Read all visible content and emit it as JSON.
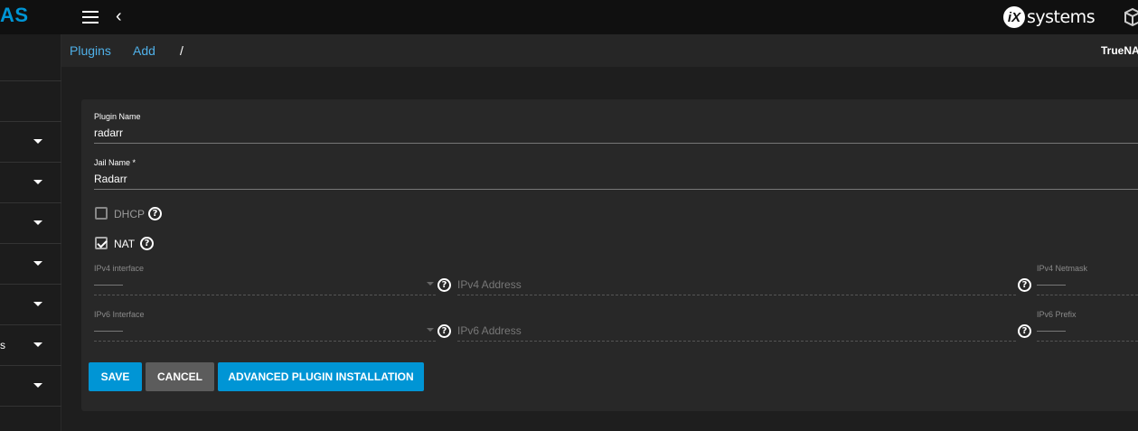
{
  "topbar": {
    "logo_text": "AS",
    "vendor_mark": "iX",
    "vendor_text": "systems"
  },
  "sidebar": {
    "items": [
      {
        "label": ""
      },
      {
        "label": ""
      },
      {
        "label": ""
      },
      {
        "label": ""
      },
      {
        "label": ""
      },
      {
        "label": "s"
      },
      {
        "label": ""
      }
    ]
  },
  "breadcrumb": {
    "items": [
      "Plugins",
      "Add"
    ],
    "separator": "/",
    "hostname": "TrueNAS"
  },
  "form": {
    "plugin_name": {
      "label": "Plugin Name",
      "value": "radarr"
    },
    "jail_name": {
      "label": "Jail Name *",
      "value": "Radarr"
    },
    "dhcp": {
      "label": "DHCP",
      "checked": false
    },
    "nat": {
      "label": "NAT",
      "checked": true
    },
    "ipv4_interface": {
      "label": "IPv4 interface",
      "value": "------"
    },
    "ipv4_address": {
      "placeholder": "IPv4 Address"
    },
    "ipv4_netmask": {
      "label": "IPv4 Netmask",
      "value": "------"
    },
    "ipv6_interface": {
      "label": "IPv6 Interface",
      "value": "------"
    },
    "ipv6_address": {
      "placeholder": "IPv6 Address"
    },
    "ipv6_prefix": {
      "label": "IPv6 Prefix",
      "value": "------"
    },
    "help_glyph": "?"
  },
  "buttons": {
    "save": "SAVE",
    "cancel": "CANCEL",
    "advanced": "ADVANCED PLUGIN INSTALLATION"
  },
  "colors": {
    "accent": "#0095d5",
    "topbar": "#101010",
    "card": "#282828"
  }
}
